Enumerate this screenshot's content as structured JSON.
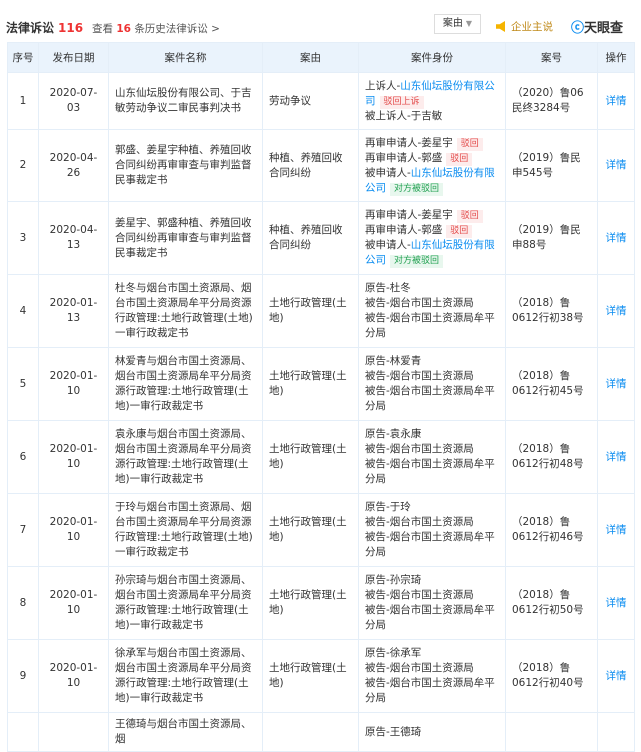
{
  "header": {
    "title": "法律诉讼",
    "count": "116",
    "history_prefix": "查看",
    "history_count": "16",
    "history_suffix": "条历史法律诉讼 >",
    "filter": "案由",
    "speaker": "企业主说",
    "logo": "天眼查"
  },
  "columns": [
    "序号",
    "发布日期",
    "案件名称",
    "案由",
    "案件身份",
    "案号",
    "操作"
  ],
  "rows": [
    {
      "no": "1",
      "date": "2020-07-03",
      "name": "山东仙坛股份有限公司、于吉敏劳动争议二审民事判决书",
      "reason": "劳动争议",
      "roles": [
        {
          "label": "上诉人-",
          "party": "山东仙坛股份有限公司",
          "link": true,
          "tag": "驳回上诉",
          "tagc": "red"
        },
        {
          "label": "被上诉人-",
          "party": "于吉敏"
        }
      ],
      "case_no": "（2020）鲁06民终3284号",
      "action": "详情"
    },
    {
      "no": "2",
      "date": "2020-04-26",
      "name": "郭盛、姜星宇种植、养殖回收合同纠纷再审审查与审判监督民事裁定书",
      "reason": "种植、养殖回收合同纠纷",
      "roles": [
        {
          "label": "再审申请人-",
          "party": "姜星宇",
          "tag": "驳回",
          "tagc": "red"
        },
        {
          "label": "再审申请人-",
          "party": "郭盛",
          "tag": "驳回",
          "tagc": "red"
        },
        {
          "label": "被申请人-",
          "party": "山东仙坛股份有限公司",
          "link": true,
          "tag": "对方被驳回",
          "tagc": "grn"
        }
      ],
      "case_no": "（2019）鲁民申545号",
      "action": "详情"
    },
    {
      "no": "3",
      "date": "2020-04-13",
      "name": "姜星宇、郭盛种植、养殖回收合同纠纷再审审查与审判监督民事裁定书",
      "reason": "种植、养殖回收合同纠纷",
      "roles": [
        {
          "label": "再审申请人-",
          "party": "姜星宇",
          "tag": "驳回",
          "tagc": "red"
        },
        {
          "label": "再审申请人-",
          "party": "郭盛",
          "tag": "驳回",
          "tagc": "red"
        },
        {
          "label": "被申请人-",
          "party": "山东仙坛股份有限公司",
          "link": true,
          "tag": "对方被驳回",
          "tagc": "grn"
        }
      ],
      "case_no": "（2019）鲁民申88号",
      "action": "详情"
    },
    {
      "no": "4",
      "date": "2020-01-13",
      "name": "杜冬与烟台市国土资源局、烟台市国土资源局牟平分局资源行政管理:土地行政管理(土地)一审行政裁定书",
      "reason": "土地行政管理(土地)",
      "roles": [
        {
          "label": "原告-",
          "party": "杜冬"
        },
        {
          "label": "被告-",
          "party": "烟台市国土资源局"
        },
        {
          "label": "被告-",
          "party": "烟台市国土资源局牟平分局"
        }
      ],
      "case_no": "（2018）鲁0612行初38号",
      "action": "详情"
    },
    {
      "no": "5",
      "date": "2020-01-10",
      "name": "林爱青与烟台市国土资源局、烟台市国土资源局牟平分局资源行政管理:土地行政管理(土地)一审行政裁定书",
      "reason": "土地行政管理(土地)",
      "roles": [
        {
          "label": "原告-",
          "party": "林爱青"
        },
        {
          "label": "被告-",
          "party": "烟台市国土资源局"
        },
        {
          "label": "被告-",
          "party": "烟台市国土资源局牟平分局"
        }
      ],
      "case_no": "（2018）鲁0612行初45号",
      "action": "详情"
    },
    {
      "no": "6",
      "date": "2020-01-10",
      "name": "袁永康与烟台市国土资源局、烟台市国土资源局牟平分局资源行政管理:土地行政管理(土地)一审行政裁定书",
      "reason": "土地行政管理(土地)",
      "roles": [
        {
          "label": "原告-",
          "party": "袁永康"
        },
        {
          "label": "被告-",
          "party": "烟台市国土资源局"
        },
        {
          "label": "被告-",
          "party": "烟台市国土资源局牟平分局"
        }
      ],
      "case_no": "（2018）鲁0612行初48号",
      "action": "详情"
    },
    {
      "no": "7",
      "date": "2020-01-10",
      "name": "于玲与烟台市国土资源局、烟台市国土资源局牟平分局资源行政管理:土地行政管理(土地)一审行政裁定书",
      "reason": "土地行政管理(土地)",
      "roles": [
        {
          "label": "原告-",
          "party": "于玲"
        },
        {
          "label": "被告-",
          "party": "烟台市国土资源局"
        },
        {
          "label": "被告-",
          "party": "烟台市国土资源局牟平分局"
        }
      ],
      "case_no": "（2018）鲁0612行初46号",
      "action": "详情"
    },
    {
      "no": "8",
      "date": "2020-01-10",
      "name": "孙宗琦与烟台市国土资源局、烟台市国土资源局牟平分局资源行政管理:土地行政管理(土地)一审行政裁定书",
      "reason": "土地行政管理(土地)",
      "roles": [
        {
          "label": "原告-",
          "party": "孙宗琦"
        },
        {
          "label": "被告-",
          "party": "烟台市国土资源局"
        },
        {
          "label": "被告-",
          "party": "烟台市国土资源局牟平分局"
        }
      ],
      "case_no": "（2018）鲁0612行初50号",
      "action": "详情"
    },
    {
      "no": "9",
      "date": "2020-01-10",
      "name": "徐承军与烟台市国土资源局、烟台市国土资源局牟平分局资源行政管理:土地行政管理(土地)一审行政裁定书",
      "reason": "土地行政管理(土地)",
      "roles": [
        {
          "label": "原告-",
          "party": "徐承军"
        },
        {
          "label": "被告-",
          "party": "烟台市国土资源局"
        },
        {
          "label": "被告-",
          "party": "烟台市国土资源局牟平分局"
        }
      ],
      "case_no": "（2018）鲁0612行初40号",
      "action": "详情"
    },
    {
      "no": "",
      "date": "",
      "name": "王德琦与烟台市国土资源局、烟",
      "reason": "",
      "roles": [
        {
          "label": "原告-",
          "party": "王德琦"
        }
      ],
      "case_no": "",
      "action": ""
    }
  ]
}
